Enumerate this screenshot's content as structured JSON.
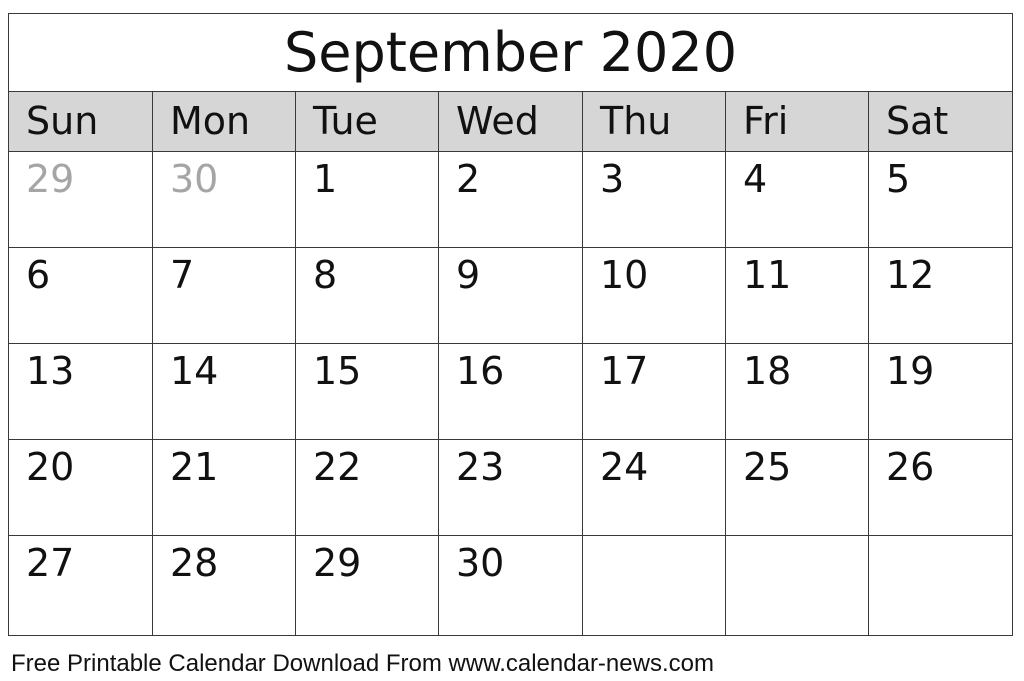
{
  "calendar": {
    "title": "September 2020",
    "weekdays": [
      "Sun",
      "Mon",
      "Tue",
      "Wed",
      "Thu",
      "Fri",
      "Sat"
    ],
    "weeks": [
      [
        {
          "day": "29",
          "other_month": true
        },
        {
          "day": "30",
          "other_month": true
        },
        {
          "day": "1"
        },
        {
          "day": "2"
        },
        {
          "day": "3"
        },
        {
          "day": "4"
        },
        {
          "day": "5"
        }
      ],
      [
        {
          "day": "6"
        },
        {
          "day": "7"
        },
        {
          "day": "8"
        },
        {
          "day": "9"
        },
        {
          "day": "10"
        },
        {
          "day": "11"
        },
        {
          "day": "12"
        }
      ],
      [
        {
          "day": "13"
        },
        {
          "day": "14"
        },
        {
          "day": "15"
        },
        {
          "day": "16"
        },
        {
          "day": "17"
        },
        {
          "day": "18"
        },
        {
          "day": "19"
        }
      ],
      [
        {
          "day": "20"
        },
        {
          "day": "21"
        },
        {
          "day": "22"
        },
        {
          "day": "23"
        },
        {
          "day": "24"
        },
        {
          "day": "25"
        },
        {
          "day": "26"
        }
      ],
      [
        {
          "day": "27"
        },
        {
          "day": "28"
        },
        {
          "day": "29"
        },
        {
          "day": "30"
        },
        {
          "day": ""
        },
        {
          "day": ""
        },
        {
          "day": ""
        }
      ]
    ],
    "colors": {
      "header_bg": "#d6d6d6",
      "other_month_text": "#a5a5a5",
      "grid_line": "#3a3a3a"
    }
  },
  "footer": {
    "text": "Free Printable Calendar Download From www.calendar-news.com"
  }
}
